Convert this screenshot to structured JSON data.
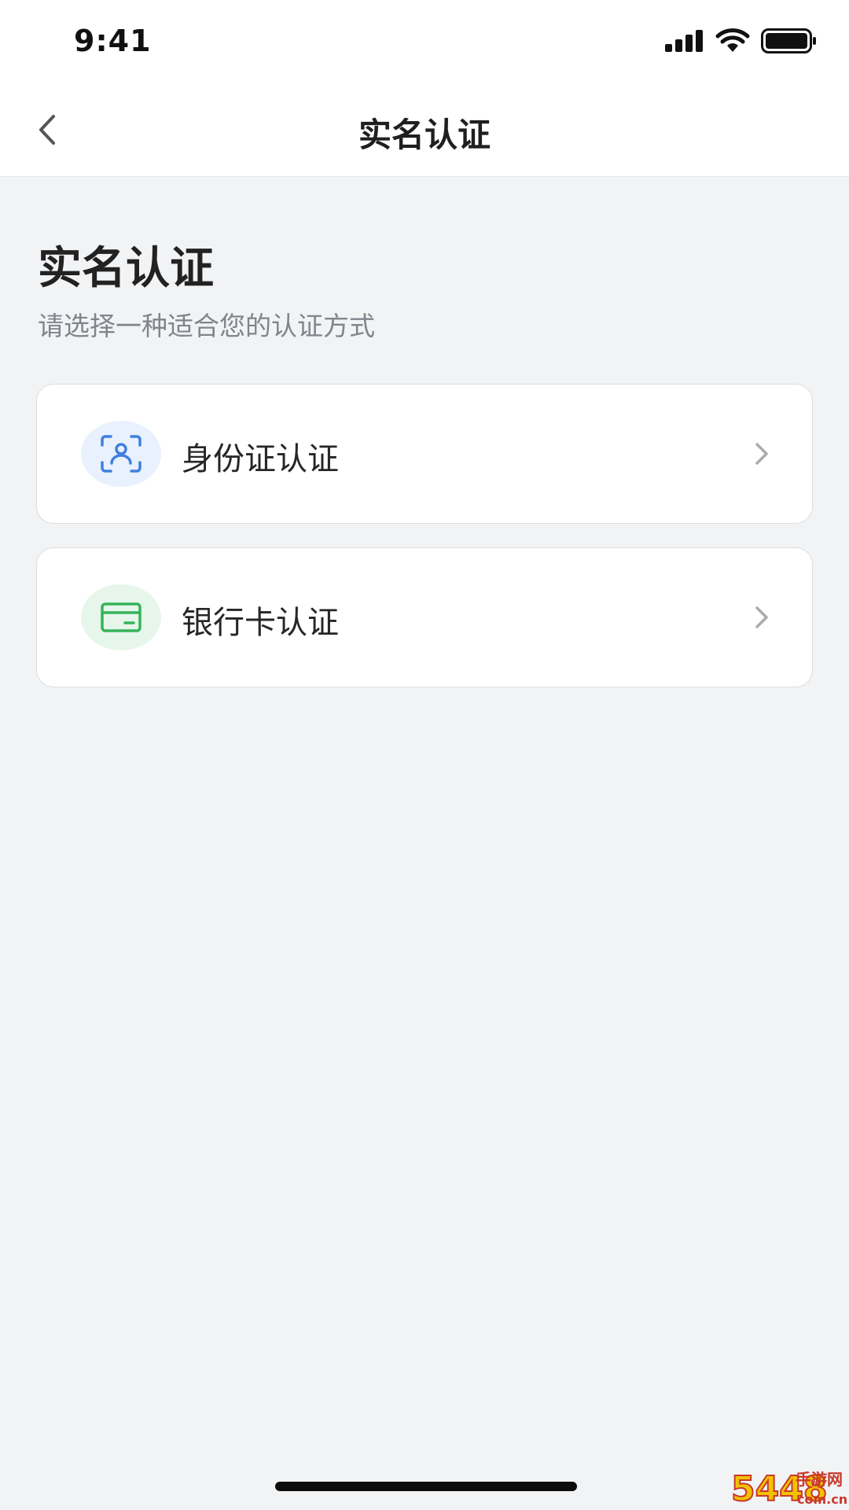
{
  "status_bar": {
    "time": "9:41",
    "icons": [
      "cellular-signal-icon",
      "wifi-icon",
      "battery-icon"
    ]
  },
  "nav": {
    "title": "实名认证",
    "back_icon": "chevron-left-icon"
  },
  "page": {
    "heading": "实名认证",
    "subtitle": "请选择一种适合您的认证方式"
  },
  "options": [
    {
      "label": "身份证认证",
      "icon": "face-scan-icon",
      "icon_color": "#3f7fe0",
      "icon_bg": "#e8f1fd"
    },
    {
      "label": "银行卡认证",
      "icon": "bank-card-icon",
      "icon_color": "#36b35a",
      "icon_bg": "#e6f6ea"
    }
  ],
  "watermark": {
    "text": "5448手游网",
    "subtext": "com.cn"
  }
}
